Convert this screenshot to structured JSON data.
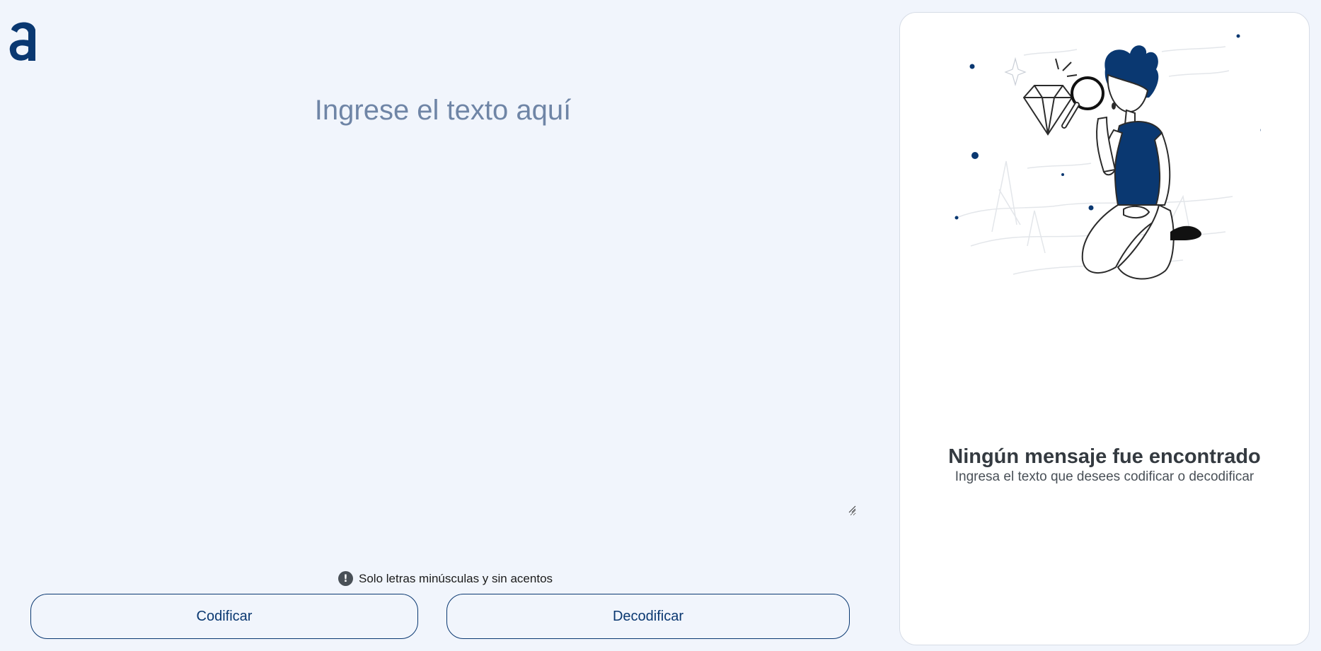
{
  "app": {
    "logo": "alura-logo"
  },
  "input": {
    "placeholder": "Ingrese el texto aquí",
    "value": ""
  },
  "hint": {
    "icon": "exclamation-icon",
    "text": "Solo letras minúsculas y sin acentos"
  },
  "actions": {
    "encrypt_label": "Codificar",
    "decrypt_label": "Decodificar"
  },
  "result": {
    "illustration": "person-with-magnifier-illustration",
    "title": "Ningún mensaje fue encontrado",
    "subtitle": "Ingresa el texto que desees codificar o decodificar"
  },
  "colors": {
    "background": "#f1f5fc",
    "accent": "#0a3871",
    "placeholder": "#6f85a6",
    "panel": "#ffffff"
  }
}
